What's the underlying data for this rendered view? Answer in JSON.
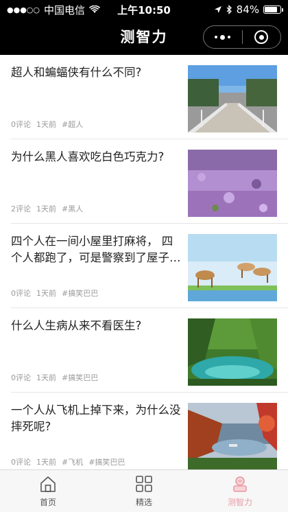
{
  "status_bar": {
    "carrier": "中国电信",
    "time": "上午10:50",
    "battery_percent": "84%",
    "battery_level": 0.84,
    "icons": [
      "signal-dots-icon",
      "wifi-icon",
      "location-arrow-icon",
      "bluetooth-icon",
      "battery-icon"
    ]
  },
  "nav": {
    "title": "测智力",
    "menu_icon": "more-dots-icon",
    "close_icon": "target-circle-icon"
  },
  "feed": {
    "items": [
      {
        "title": "超人和蝙蝠侠有什么不同?",
        "comments": "0评论",
        "time": "1天前",
        "tags": [
          "#超人"
        ],
        "image": "bridge-photo"
      },
      {
        "title": "为什么黑人喜欢吃白色巧克力?",
        "comments": "2评论",
        "time": "1天前",
        "tags": [
          "#黑人"
        ],
        "image": "lavender-field-photo"
      },
      {
        "title": "四个人在一间小屋里打麻将， 四个人都跑了，可是警察到了屋子里，却一个人也没抓到，为什么？",
        "comments": "0评论",
        "time": "1天前",
        "tags": [
          "#搞笑巴巴"
        ],
        "image": "horses-photo"
      },
      {
        "title": "什么人生病从来不看医生?",
        "comments": "0评论",
        "time": "1天前",
        "tags": [
          "#搞笑巴巴"
        ],
        "image": "forest-lake-photo"
      },
      {
        "title": "一个人从飞机上掉下来，为什么没摔死呢?",
        "comments": "0评论",
        "time": "1天前",
        "tags": [
          "#飞机",
          "#搞笑巴巴"
        ],
        "image": "autumn-lake-photo"
      }
    ]
  },
  "tab_bar": {
    "tabs": [
      {
        "label": "首页",
        "icon": "home-icon",
        "active": false
      },
      {
        "label": "精选",
        "icon": "grid-icon",
        "active": false
      },
      {
        "label": "测智力",
        "icon": "brain-quiz-icon",
        "active": true
      }
    ],
    "active_color": "#e89aa2",
    "inactive_color": "#555555"
  }
}
